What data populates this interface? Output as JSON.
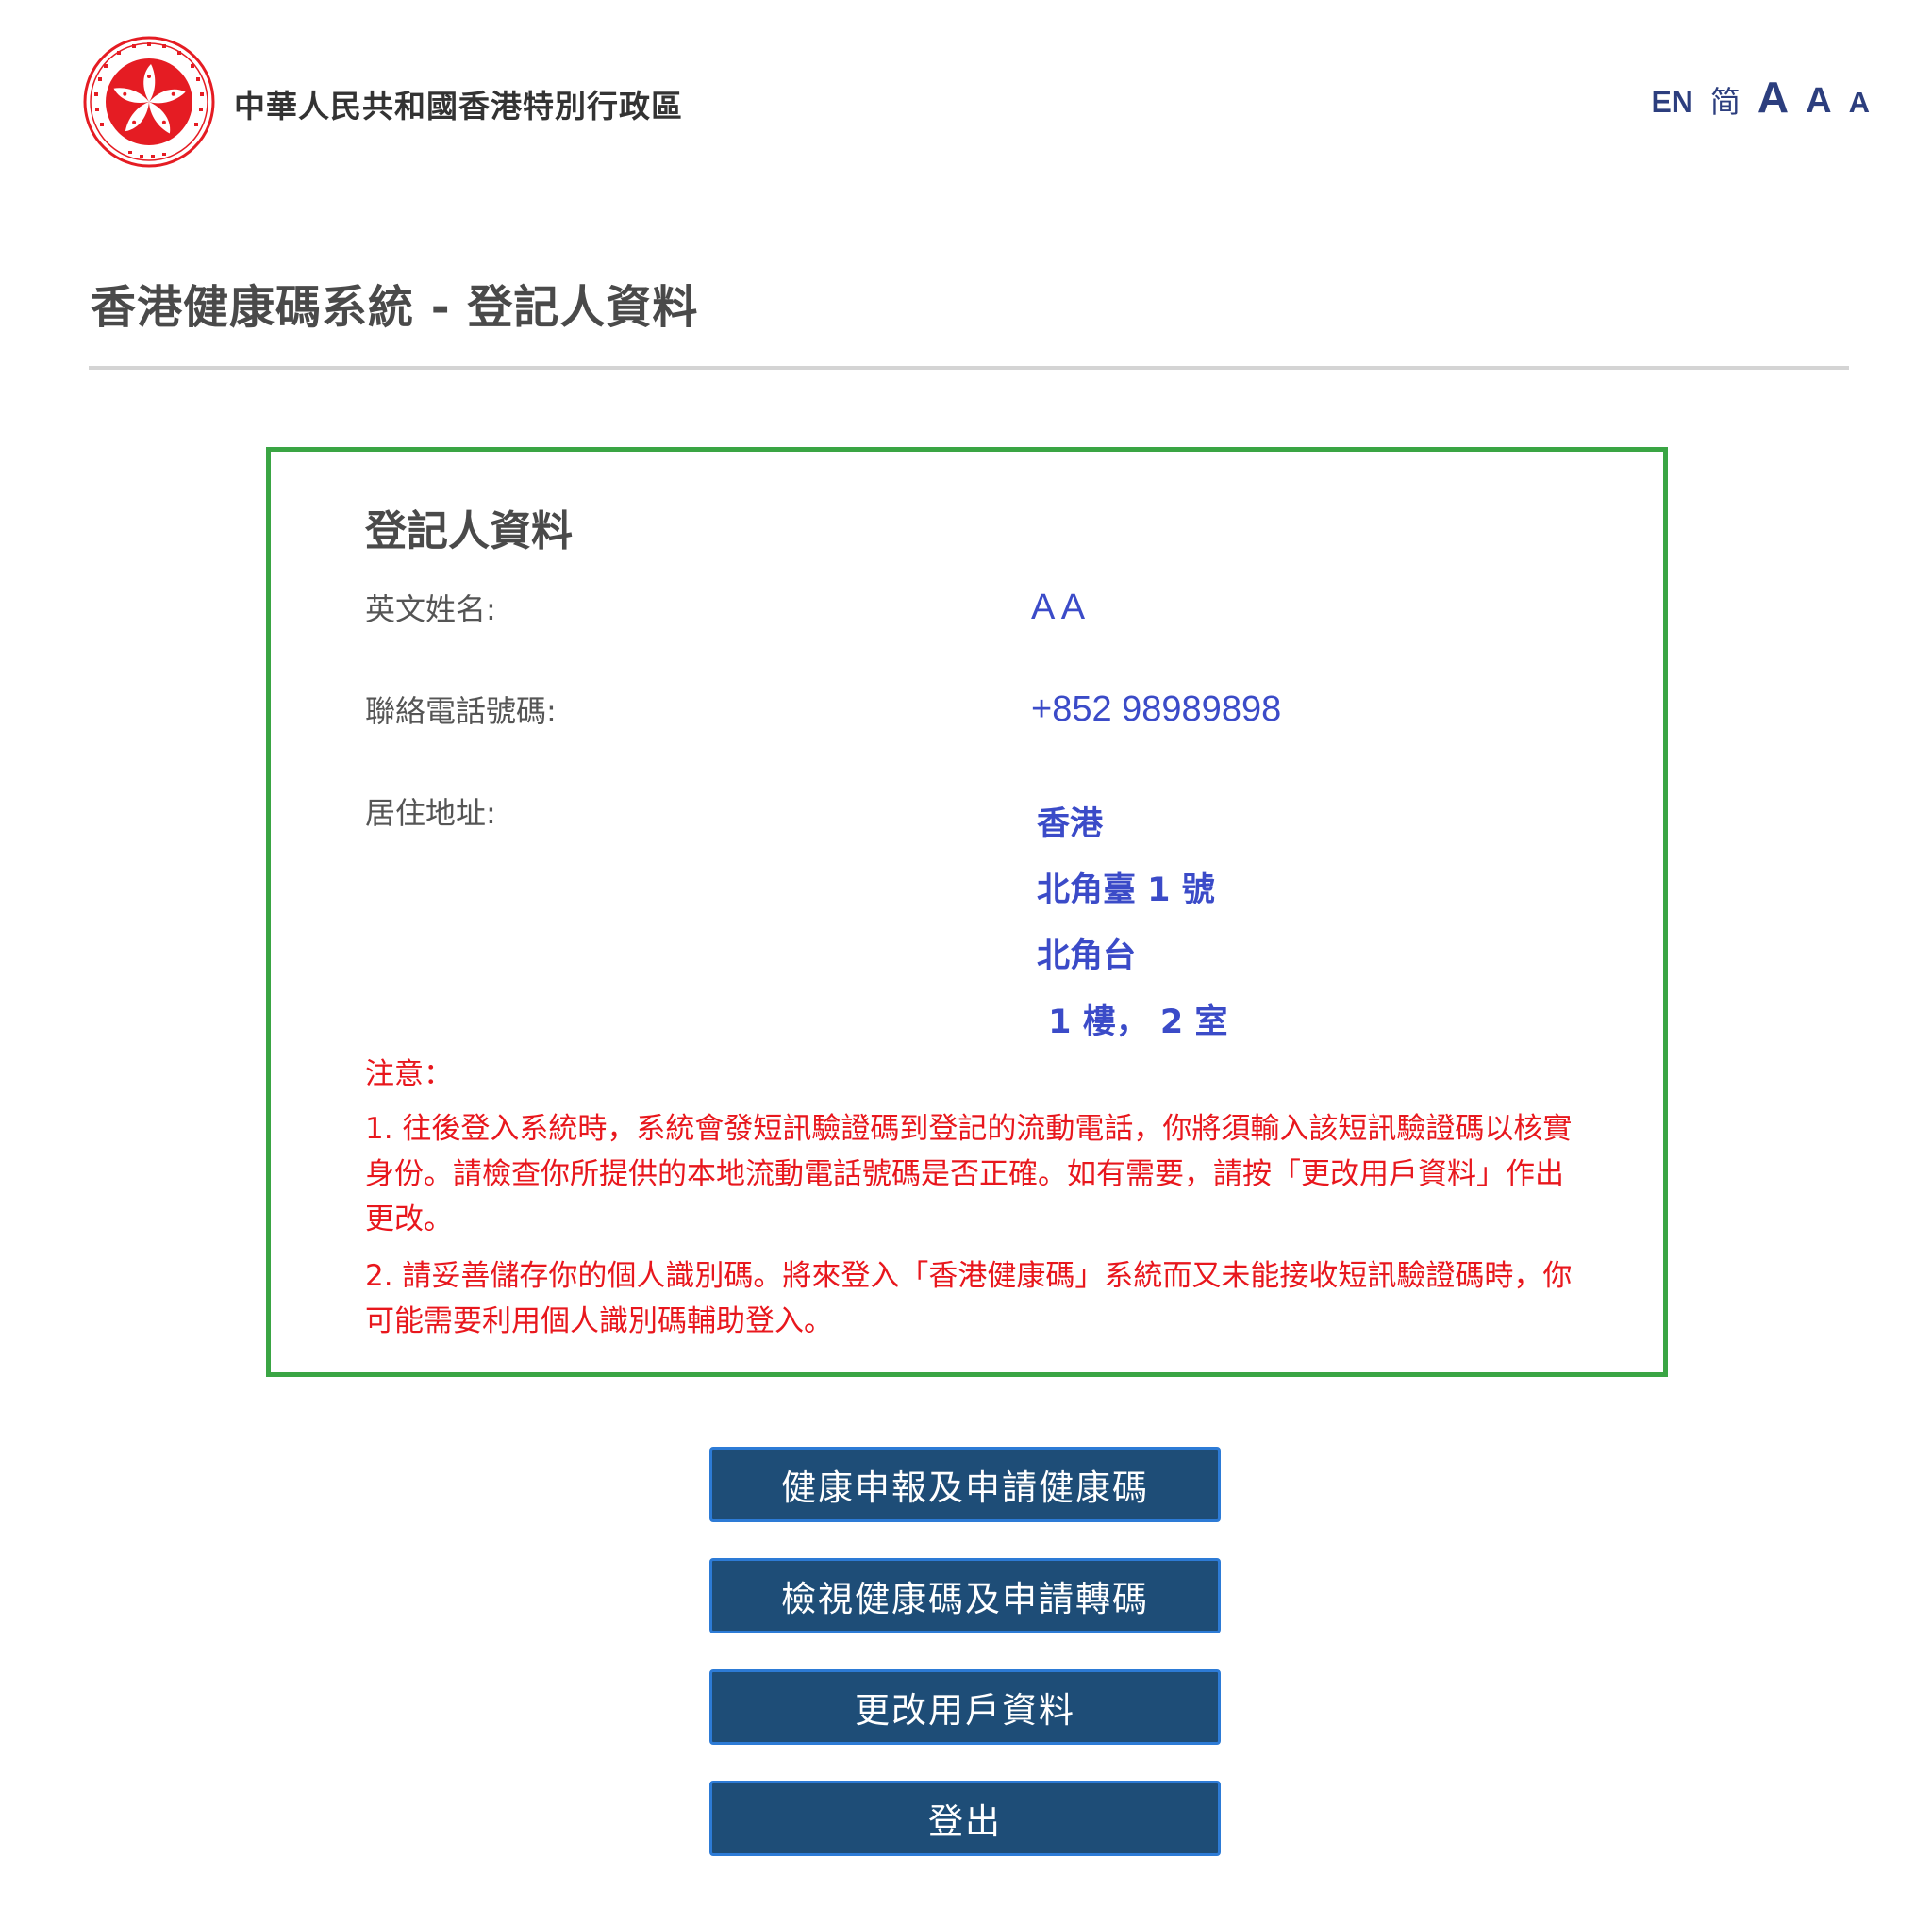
{
  "header": {
    "emblem_icon": "hksar-regional-emblem-icon",
    "government_name": "中華人民共和國香港特別行政區",
    "language": {
      "english_label": "EN",
      "simplified_label": "简"
    },
    "font_size": {
      "large_label": "A",
      "medium_label": "A",
      "small_label": "A"
    }
  },
  "page": {
    "title": "香港健康碼系統 - 登記人資料"
  },
  "registrant": {
    "section_title": "登記人資料",
    "english_name_label": "英文姓名:",
    "english_name_value": "A A",
    "phone_label": "聯絡電話號碼:",
    "phone_value": "+852 98989898",
    "address_label": "居住地址:",
    "address_lines": [
      "香港",
      "北角臺 1 號",
      "北角台",
      " 1 樓， 2 室"
    ]
  },
  "notice": {
    "title": "注意：",
    "item1": "1. 往後登入系統時，系統會發短訊驗證碼到登記的流動電話，你將須輸入該短訊驗證碼以核實身份。請檢查你所提供的本地流動電話號碼是否正確。如有需要，請按「更改用戶資料」作出更改。",
    "item2": "2. 請妥善儲存你的個人識別碼。將來登入「香港健康碼」系統而又未能接收短訊驗證碼時，你可能需要利用個人識別碼輔助登入。"
  },
  "actions": {
    "health_declaration_label": "健康申報及申請健康碼",
    "view_code_label": "檢視健康碼及申請轉碼",
    "edit_profile_label": "更改用戶資料",
    "logout_label": "登出"
  },
  "colors": {
    "box_border": "#3aa544",
    "value_text": "#3b4bc8",
    "notice_text": "#e8171d",
    "button_bg": "#1e4d77",
    "lang_text": "#2c3e7e",
    "emblem_red": "#e51c23"
  }
}
